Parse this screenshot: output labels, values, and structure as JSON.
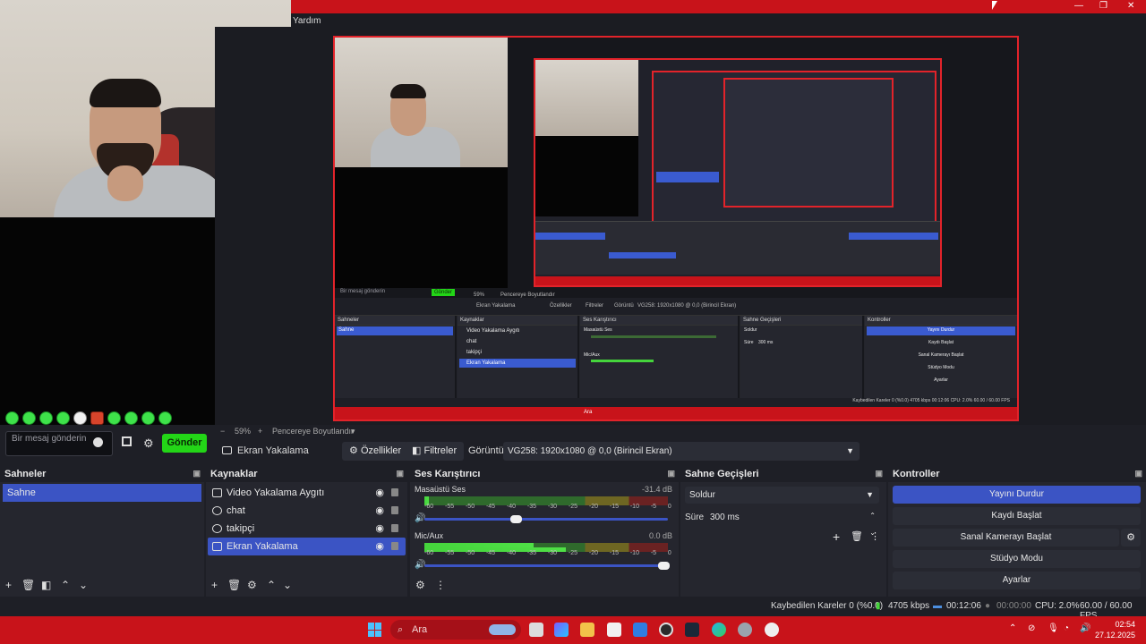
{
  "window": {
    "menu_help": "Yardım"
  },
  "chat": {
    "placeholder": "Bir mesaj gönderin",
    "send_label": "Gönder"
  },
  "preview": {
    "zoom": "59%",
    "fit_label": "Pencereye Boyutlandır"
  },
  "source_bar": {
    "source_name": "Ekran Yakalama",
    "properties_label": "Özellikler",
    "filters_label": "Filtreler",
    "display_label": "Görüntü",
    "display_value": "VG258: 1920x1080 @ 0,0 (Birincil Ekran)"
  },
  "scenes": {
    "title": "Sahneler",
    "items": [
      "Sahne"
    ]
  },
  "sources": {
    "title": "Kaynaklar",
    "items": [
      {
        "label": "Video Yakalama Aygıtı",
        "icon": "camera-icon"
      },
      {
        "label": "chat",
        "icon": "globe-icon"
      },
      {
        "label": "takipçi",
        "icon": "globe-icon"
      },
      {
        "label": "Ekran Yakalama",
        "icon": "monitor-icon"
      }
    ]
  },
  "mixer": {
    "title": "Ses Karıştırıcı",
    "channels": [
      {
        "name": "Masaüstü Ses",
        "db": "-31.4 dB",
        "level": 0.02,
        "volume": 0.36
      },
      {
        "name": "Mic/Aux",
        "db": "0.0 dB",
        "level": 0.45,
        "volume": 0.98
      }
    ],
    "ticks": [
      "-60",
      "-55",
      "-50",
      "-45",
      "-40",
      "-35",
      "-30",
      "-25",
      "-20",
      "-15",
      "-10",
      "-5",
      "0"
    ]
  },
  "transitions": {
    "title": "Sahne Geçişleri",
    "selected": "Soldur",
    "duration_label": "Süre",
    "duration_value": "300 ms"
  },
  "controls": {
    "title": "Kontroller",
    "stop_stream": "Yayını Durdur",
    "start_record": "Kaydı Başlat",
    "virtual_cam": "Sanal Kamerayı Başlat",
    "studio_mode": "Stüdyo Modu",
    "settings": "Ayarlar"
  },
  "status": {
    "dropped": "Kaybedilen Kareler 0 (%0.0)",
    "bitrate": "4705 kbps",
    "stream_time": "00:12:06",
    "record_time": "00:00:00",
    "cpu": "CPU: 2.0%",
    "fps": "60.00 / 60.00 FPS"
  },
  "taskbar": {
    "search": "Ara",
    "time": "02:54",
    "date": "27.12.2025"
  },
  "mini": {
    "zoom": "59%",
    "fit": "Pencereye Boyutlandır",
    "source": "Ekran Yakalama",
    "props": "Özellikler",
    "filters": "Filtreler",
    "display": "Görüntü",
    "display_value": "VG258: 1920x1080 @ 0,0 (Birincil Ekran)",
    "scenes": "Sahneler",
    "scene": "Sahne",
    "sources": "Kaynaklar",
    "src1": "Video Yakalama Aygıtı",
    "src2": "chat",
    "src3": "takipçi",
    "src4": "Ekran Yakalama",
    "mixer": "Ses Karıştırıcı",
    "desktop": "Masaüstü Ses",
    "mic": "Mic/Aux",
    "transitions": "Sahne Geçişleri",
    "fade": "Soldur",
    "duration": "Süre",
    "duration_value": "300 ms",
    "controls": "Kontroller",
    "stop": "Yayını Durdur",
    "record": "Kaydı Başlat",
    "vcam": "Sanal Kamerayı Başlat",
    "studio": "Stüdyo Modu",
    "settings": "Ayarlar",
    "status": "Kaybedilen Kareler 0 (%0.0)  4705 kbps  00:12:06  CPU: 2.0%  60.00 / 60.00 FPS",
    "search": "Ara",
    "chat_placeholder": "Bir mesaj gönderin",
    "send": "Gönder"
  }
}
